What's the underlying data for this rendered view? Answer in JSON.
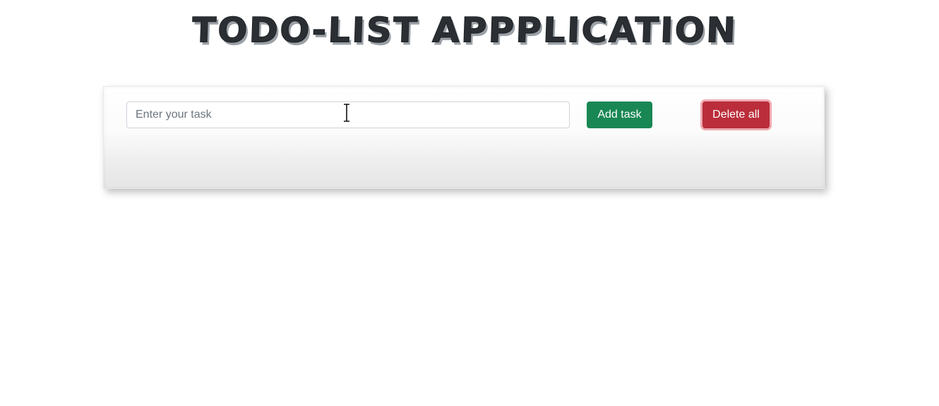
{
  "header": {
    "title": "TODO-LIST APPPLICATION"
  },
  "todo_form": {
    "task_input": {
      "value": "",
      "placeholder": "Enter your task"
    },
    "add_button_label": "Add task",
    "delete_all_button_label": "Delete all"
  },
  "tasks": [],
  "colors": {
    "add_button": "#198754",
    "delete_button": "#bb2d3b",
    "title_text": "#2b2f33"
  },
  "icons": {
    "cursor": "text-cursor-icon"
  }
}
